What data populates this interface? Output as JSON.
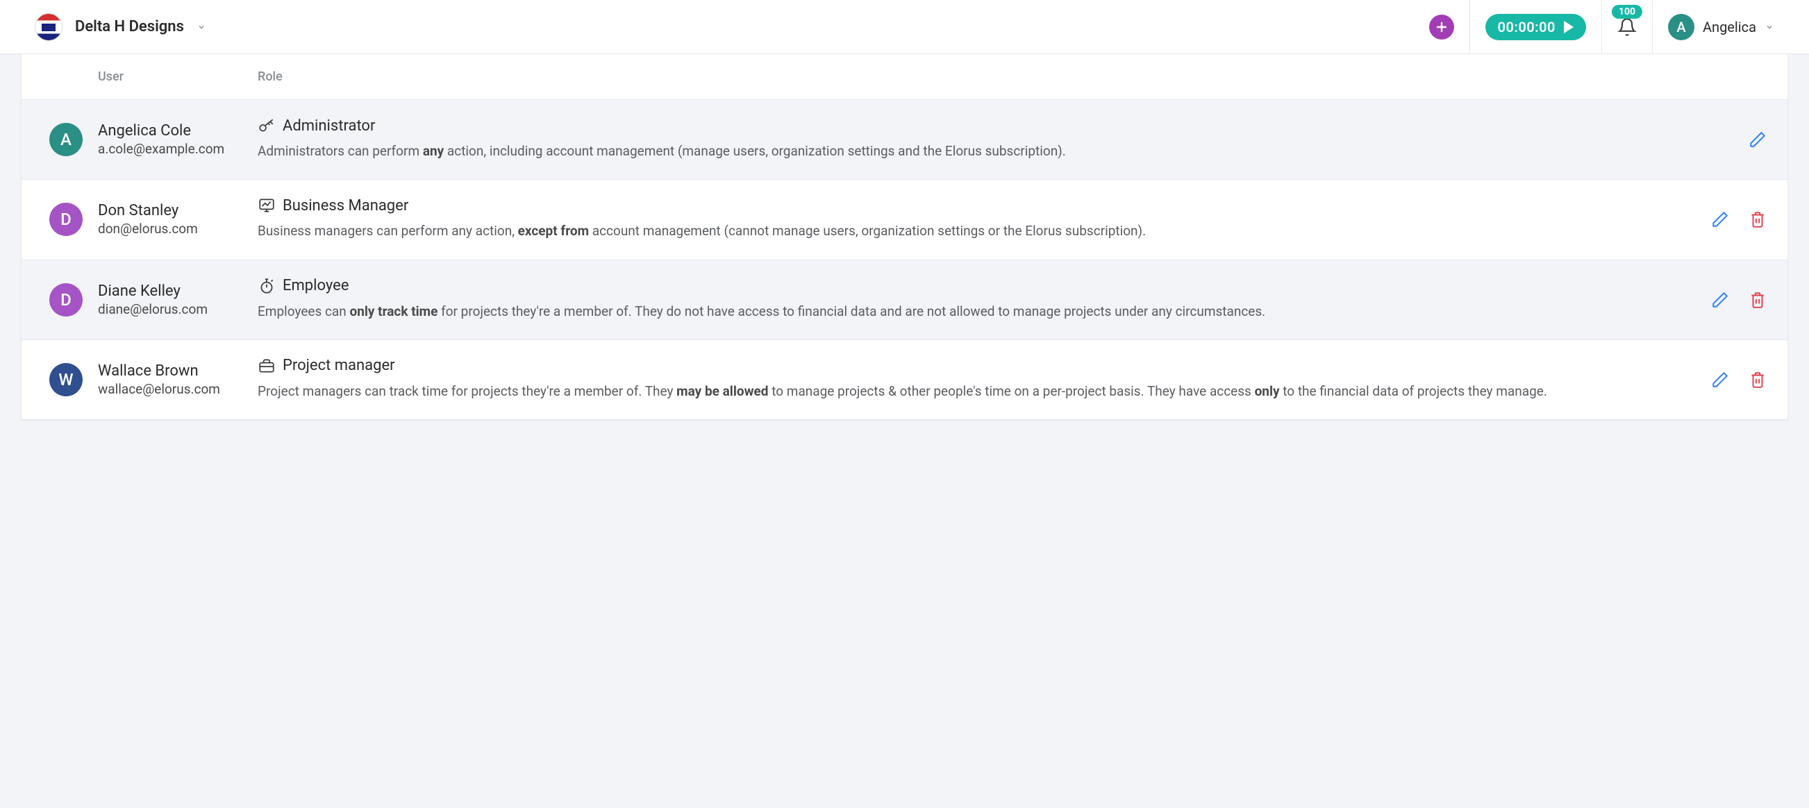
{
  "header": {
    "org_name": "Delta H Designs",
    "timer": "00:00:00",
    "notification_count": "100",
    "user_name": "Angelica",
    "user_initial": "A"
  },
  "table": {
    "headers": {
      "user": "User",
      "role": "Role"
    },
    "rows": [
      {
        "initial": "A",
        "avatar_color": "teal",
        "name": "Angelica Cole",
        "email": "a.cole@example.com",
        "role_title": "Administrator",
        "role_icon": "key",
        "desc_pre": "Administrators can perform ",
        "desc_bold1": "any",
        "desc_mid": " action, including account management (manage users, organization settings and the Elorus subscription).",
        "desc_bold2": "",
        "desc_post": "",
        "shaded": true,
        "deletable": false
      },
      {
        "initial": "D",
        "avatar_color": "purple",
        "name": "Don Stanley",
        "email": "don@elorus.com",
        "role_title": "Business Manager",
        "role_icon": "chart",
        "desc_pre": "Business managers can perform any action, ",
        "desc_bold1": "except from",
        "desc_mid": " account management (cannot manage users, organization settings or the Elorus subscription).",
        "desc_bold2": "",
        "desc_post": "",
        "shaded": false,
        "deletable": true
      },
      {
        "initial": "D",
        "avatar_color": "purple",
        "name": "Diane Kelley",
        "email": "diane@elorus.com",
        "role_title": "Employee",
        "role_icon": "stopwatch",
        "desc_pre": "Employees can ",
        "desc_bold1": "only track time",
        "desc_mid": " for projects they're a member of. They do not have access to financial data and are not allowed to manage projects under any circumstances.",
        "desc_bold2": "",
        "desc_post": "",
        "shaded": true,
        "deletable": true
      },
      {
        "initial": "W",
        "avatar_color": "navy",
        "name": "Wallace Brown",
        "email": "wallace@elorus.com",
        "role_title": "Project manager",
        "role_icon": "briefcase",
        "desc_pre": "Project managers can track time for projects they're a member of. They ",
        "desc_bold1": "may be allowed",
        "desc_mid": " to manage projects & other people's time on a per-project basis. They have access ",
        "desc_bold2": "only",
        "desc_post": " to the financial data of projects they manage.",
        "shaded": false,
        "deletable": true
      }
    ]
  },
  "colors": {
    "teal": "#2a8f85",
    "purple": "#a554c6",
    "navy": "#2f4f8f",
    "accent_purple": "#a23db5",
    "accent_teal": "#17b8a6",
    "edit_blue": "#2d7ff9",
    "delete_red": "#e2414d"
  }
}
